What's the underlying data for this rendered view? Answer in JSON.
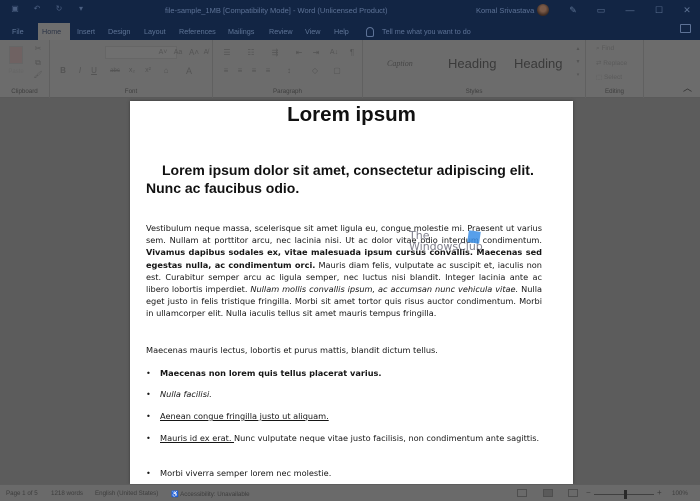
{
  "titlebar": {
    "document_title": "file-sample_1MB [Compatibility Mode]  -  Word (Unlicensed Product)",
    "user_name": "Komal Srivastava",
    "qat_icons": [
      "save-icon",
      "undo-icon",
      "redo-icon",
      "customize-qat-icon"
    ],
    "controls": {
      "pen": "✎",
      "ribbon_display": "▭",
      "minimize": "—",
      "maximize": "☐",
      "close": "✕"
    }
  },
  "tabs": [
    {
      "label": "File",
      "active": false
    },
    {
      "label": "Home",
      "active": true
    },
    {
      "label": "Insert",
      "active": false
    },
    {
      "label": "Design",
      "active": false
    },
    {
      "label": "Layout",
      "active": false
    },
    {
      "label": "References",
      "active": false
    },
    {
      "label": "Mailings",
      "active": false
    },
    {
      "label": "Review",
      "active": false
    },
    {
      "label": "View",
      "active": false
    },
    {
      "label": "Help",
      "active": false
    }
  ],
  "tell_me": {
    "placeholder": "Tell me what you want to do"
  },
  "ribbon": {
    "clipboard": {
      "label": "Clipboard",
      "paste_label": "Paste",
      "icons": {
        "cut": "✂",
        "copy": "⧉",
        "format_painter": "🖌"
      }
    },
    "font": {
      "label": "Font",
      "font_name": "",
      "buttons": {
        "grow": "A˄",
        "shrink": "A˅",
        "case": "Aa",
        "clear": "A̸",
        "bold": "B",
        "italic": "I",
        "underline": "U",
        "strike": "abc",
        "subscript": "x₂",
        "superscript": "x²",
        "highlight": "⌂",
        "font_color": "A"
      }
    },
    "paragraph": {
      "label": "Paragraph",
      "buttons": {
        "bullets": "☰",
        "numbering": "☷",
        "multilevel": "⇶",
        "decrease_indent": "⇤",
        "increase_indent": "⇥",
        "sort": "A↓",
        "show_marks": "¶",
        "align_left": "≡",
        "center": "≡",
        "align_right": "≡",
        "justify": "≡",
        "line_spacing": "↕",
        "shading": "◇",
        "borders": "▢"
      }
    },
    "styles": {
      "label": "Styles",
      "items": [
        "Caption",
        "Heading",
        "Heading"
      ]
    },
    "editing": {
      "label": "Editing",
      "find": "Find",
      "replace": "Replace",
      "select": "Select"
    }
  },
  "document": {
    "title": "Lorem ipsum",
    "subtitle": "Lorem ipsum dolor sit amet, consectetur adipiscing elit. Nunc ac faucibus odio.",
    "paragraph1": {
      "part1": "Vestibulum neque massa, scelerisque sit amet ligula eu, congue molestie mi. Praesent ut varius sem. Nullam at porttitor arcu, nec lacinia nisi. Ut ac dolor vitae odio interdum condimentum. ",
      "bold": "Vivamus dapibus sodales ex, vitae malesuada ipsum cursus convallis. Maecenas sed egestas nulla, ac condimentum orci.",
      "part2": " Mauris diam felis, vulputate ac suscipit et, iaculis non est. Curabitur semper arcu ac ligula semper, nec luctus nisi blandit. Integer lacinia ante ac libero lobortis imperdiet. ",
      "italic": "Nullam mollis convallis ipsum, ac accumsan nunc vehicula vitae.",
      "part3": " Nulla eget justo in felis tristique fringilla. Morbi sit amet tortor quis risus auctor condimentum. Morbi in ullamcorper elit. Nulla iaculis tellus sit amet mauris tempus fringilla."
    },
    "paragraph2": "Maecenas mauris lectus, lobortis et purus mattis, blandit dictum tellus.",
    "bullets": [
      {
        "text": "Maecenas non lorem quis tellus placerat varius.",
        "style": "bold"
      },
      {
        "text": "Nulla facilisi.",
        "style": "italic"
      },
      {
        "text": "Aenean congue fringilla justo ut aliquam. ",
        "style": "underline"
      },
      {
        "underlined": "Mauris id ex erat. ",
        "text": "Nunc vulputate neque vitae justo facilisis, non condimentum ante sagittis.",
        "style": "mixed"
      },
      {
        "text": "Morbi viverra semper lorem nec molestie.",
        "style": "normal"
      }
    ],
    "watermark": {
      "line1": "The",
      "line2": "WindowsClub"
    }
  },
  "statusbar": {
    "page": "Page 1 of 5",
    "words": "1218 words",
    "language": "English (United States)",
    "accessibility": "Accessibility: Unavailable",
    "zoom": "100%",
    "zoom_minus": "−",
    "zoom_plus": "+"
  }
}
